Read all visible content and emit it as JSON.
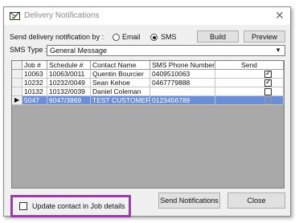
{
  "window": {
    "title": "Delivery Notifications",
    "close_icon": "close-icon"
  },
  "send_by": {
    "label": "Send delivery notification by :",
    "options": [
      {
        "label": "Email",
        "selected": false
      },
      {
        "label": "SMS",
        "selected": true
      }
    ]
  },
  "buttons": {
    "build": "Build",
    "preview": "Preview",
    "send_notifications": "Send Notifications",
    "close": "Close"
  },
  "sms_type": {
    "label": "SMS Type :",
    "value": "General Message"
  },
  "grid": {
    "columns": [
      "Job #",
      "Schedule #",
      "Contact Name",
      "SMS Phone Number",
      "Send"
    ],
    "rows": [
      {
        "job": "10063",
        "schedule": "10063/0011",
        "contact": "Quentin Bourcier",
        "phone": "0409510063",
        "send": true,
        "selected": false
      },
      {
        "job": "10232",
        "schedule": "10232/0049",
        "contact": "Sean Kehoe",
        "phone": "0467779888",
        "send": true,
        "selected": false
      },
      {
        "job": "10132",
        "schedule": "10132/0039",
        "contact": "Daniel Coleman",
        "phone": "",
        "send": false,
        "selected": false
      },
      {
        "job": "5047",
        "schedule": "6047/3869",
        "contact": "TEST CUSTOMEF",
        "phone": "0123456789",
        "send": false,
        "selected": true
      }
    ]
  },
  "update_contact": {
    "label": "Update contact in Job details",
    "checked": false
  },
  "colors": {
    "selection": "#6b8fd6",
    "highlight_border": "#9a3fa5"
  }
}
